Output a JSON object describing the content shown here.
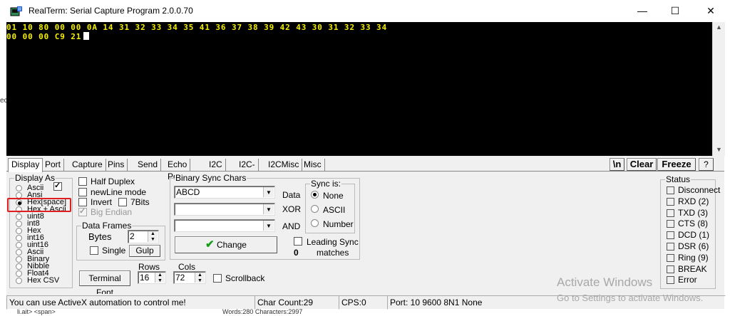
{
  "window": {
    "title": "RealTerm: Serial Capture Program 2.0.0.70",
    "minimize_glyph": "—",
    "maximize_glyph": "☐",
    "close_glyph": "✕"
  },
  "terminal": {
    "lines": [
      "01 10 80 00 00 0A 14 31 32 33 34 35 41 36 37 38 39 42 43 30 31 32 33 34",
      "00 00 00 C9 21"
    ],
    "text_color": "#f5f000",
    "background": "#000000"
  },
  "tabs": [
    {
      "label": "Display",
      "active": true
    },
    {
      "label": "Port"
    },
    {
      "label": "Capture"
    },
    {
      "label": "Pins"
    },
    {
      "label": "Send"
    },
    {
      "label": "Echo Port"
    },
    {
      "label": "I2C"
    },
    {
      "label": "I2C-2"
    },
    {
      "label": "I2CMisc"
    },
    {
      "label": "Misc"
    }
  ],
  "toolbar": {
    "newline_label": "\\n",
    "clear_label": "Clear",
    "freeze_label": "Freeze",
    "help_label": "?"
  },
  "display_as": {
    "title": "Display As",
    "options": [
      "Ascii",
      "Ansi",
      "Hex[space]",
      "Hex + Ascii",
      "uint8",
      "int8",
      "Hex",
      "int16",
      "uint16",
      "Ascii",
      "Binary",
      "Nibble",
      "Float4",
      "Hex CSV"
    ],
    "selected_index": 2
  },
  "options": {
    "half_duplex": "Half Duplex",
    "newline_mode": "newLine mode",
    "invert": "Invert",
    "seven_bits": "7Bits",
    "big_endian": "Big Endian"
  },
  "data_frames": {
    "title": "Data Frames",
    "bytes_label": "Bytes",
    "bytes_value": "2",
    "single_label": "Single",
    "gulp_label": "Gulp"
  },
  "binary_sync": {
    "title": "Binary Sync Chars",
    "data_value": "ABCD",
    "data_label": "Data",
    "xor_value": "",
    "xor_label": "XOR",
    "and_value": "",
    "and_label": "AND",
    "change_label": "Change",
    "leading_sync_label": "Leading Sync",
    "matches_label": "matches",
    "matches_count": "0"
  },
  "sync_is": {
    "title": "Sync is:",
    "options": [
      "None",
      "ASCII",
      "Number"
    ],
    "selected_index": 0
  },
  "terminal_font": {
    "button_label": "Terminal Font",
    "rows_label": "Rows",
    "rows_value": "16",
    "cols_label": "Cols",
    "cols_value": "72",
    "scrollback_label": "Scrollback"
  },
  "status": {
    "title": "Status",
    "items": [
      "Disconnect",
      "RXD (2)",
      "TXD (3)",
      "CTS (8)",
      "DCD (1)",
      "DSR (6)",
      "Ring (9)",
      "BREAK",
      "Error"
    ]
  },
  "statusbar": {
    "message": "You can use ActiveX automation to control me!",
    "char_count": "Char Count:29",
    "cps": "CPS:0",
    "port": "Port: 10 9600 8N1 None"
  },
  "watermark": {
    "line1": "Activate Windows",
    "line2": "Go to Settings to activate Windows."
  },
  "background_window": {
    "left_fragment": "ec",
    "bottom_left": "li.ait> <span>",
    "bottom_words": "Words:280 Characters:2997"
  },
  "colors": {
    "highlight": "#e02020",
    "dialog_bg": "#f0f0f0"
  }
}
